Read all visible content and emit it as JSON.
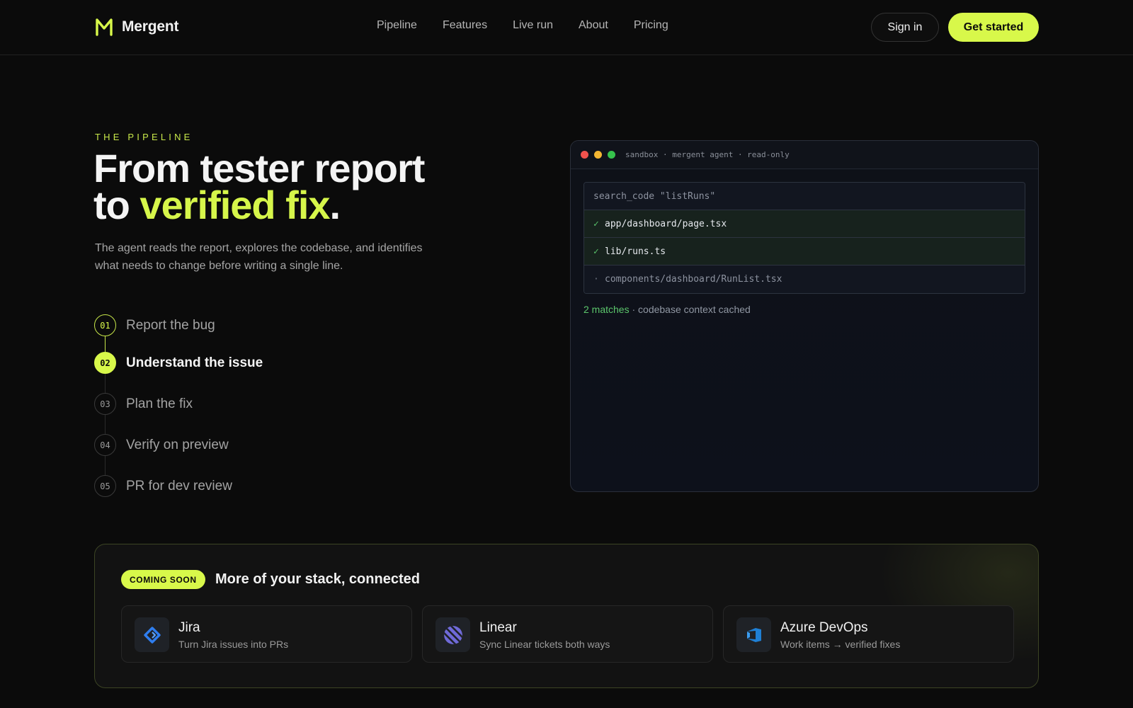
{
  "brand": {
    "name": "Mergent"
  },
  "nav": {
    "links": [
      "Pipeline",
      "Features",
      "Live run",
      "About",
      "Pricing"
    ],
    "signin": "Sign in",
    "cta": "Get started"
  },
  "hero": {
    "eyebrow": "THE PIPELINE",
    "headline_line1": "From tester report",
    "headline_to": "to ",
    "headline_accent": "verified fix",
    "headline_period": ".",
    "subcopy": "The agent reads the report, explores the codebase, and identifies what needs to change before writing a single line."
  },
  "steps": [
    {
      "num": "01",
      "label": "Report the bug",
      "state": "done"
    },
    {
      "num": "02",
      "label": "Understand the issue",
      "state": "active"
    },
    {
      "num": "03",
      "label": "Plan the fix",
      "state": "pending"
    },
    {
      "num": "04",
      "label": "Verify on preview",
      "state": "pending"
    },
    {
      "num": "05",
      "label": "PR for dev review",
      "state": "pending"
    }
  ],
  "terminal": {
    "title": "sandbox · mergent agent · read-only",
    "command": "search_code \"listRuns\"",
    "results": [
      {
        "mark": "✓",
        "path": "app/dashboard/page.tsx",
        "matched": true
      },
      {
        "mark": "✓",
        "path": "lib/runs.ts",
        "matched": true
      },
      {
        "mark": "·",
        "path": "components/dashboard/RunList.tsx",
        "matched": false
      }
    ],
    "status_ok": "2 matches",
    "status_rest": " · codebase context cached"
  },
  "integrations": {
    "badge": "COMING SOON",
    "title": "More of your stack, connected",
    "items": [
      {
        "name": "Jira",
        "desc": "Turn Jira issues into PRs",
        "icon": "jira-icon"
      },
      {
        "name": "Linear",
        "desc": "Sync Linear tickets both ways",
        "icon": "linear-icon"
      },
      {
        "name": "Azure DevOps",
        "desc": "Work items → verified fixes",
        "icon": "azure-devops-icon"
      }
    ]
  },
  "colors": {
    "accent": "#d8f84a",
    "background": "#0b0b0b",
    "success": "#5cc66c",
    "jira": "#2f7ef0",
    "linear": "#6f6ad8",
    "azure": "#1f7fd4"
  }
}
